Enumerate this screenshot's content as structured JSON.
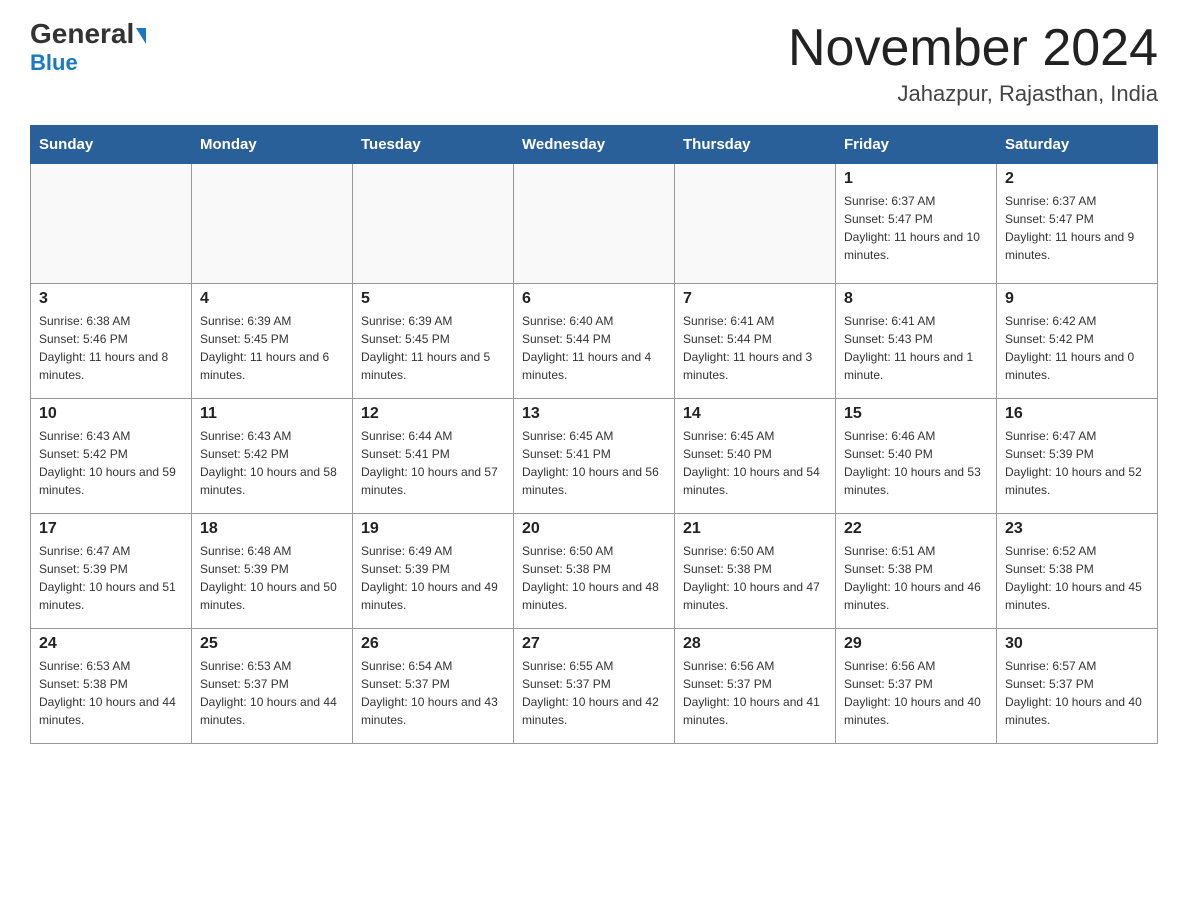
{
  "header": {
    "logo_main": "General",
    "logo_blue": "Blue",
    "month": "November 2024",
    "location": "Jahazpur, Rajasthan, India"
  },
  "days_of_week": [
    "Sunday",
    "Monday",
    "Tuesday",
    "Wednesday",
    "Thursday",
    "Friday",
    "Saturday"
  ],
  "weeks": [
    [
      {
        "day": "",
        "info": ""
      },
      {
        "day": "",
        "info": ""
      },
      {
        "day": "",
        "info": ""
      },
      {
        "day": "",
        "info": ""
      },
      {
        "day": "",
        "info": ""
      },
      {
        "day": "1",
        "info": "Sunrise: 6:37 AM\nSunset: 5:47 PM\nDaylight: 11 hours and 10 minutes."
      },
      {
        "day": "2",
        "info": "Sunrise: 6:37 AM\nSunset: 5:47 PM\nDaylight: 11 hours and 9 minutes."
      }
    ],
    [
      {
        "day": "3",
        "info": "Sunrise: 6:38 AM\nSunset: 5:46 PM\nDaylight: 11 hours and 8 minutes."
      },
      {
        "day": "4",
        "info": "Sunrise: 6:39 AM\nSunset: 5:45 PM\nDaylight: 11 hours and 6 minutes."
      },
      {
        "day": "5",
        "info": "Sunrise: 6:39 AM\nSunset: 5:45 PM\nDaylight: 11 hours and 5 minutes."
      },
      {
        "day": "6",
        "info": "Sunrise: 6:40 AM\nSunset: 5:44 PM\nDaylight: 11 hours and 4 minutes."
      },
      {
        "day": "7",
        "info": "Sunrise: 6:41 AM\nSunset: 5:44 PM\nDaylight: 11 hours and 3 minutes."
      },
      {
        "day": "8",
        "info": "Sunrise: 6:41 AM\nSunset: 5:43 PM\nDaylight: 11 hours and 1 minute."
      },
      {
        "day": "9",
        "info": "Sunrise: 6:42 AM\nSunset: 5:42 PM\nDaylight: 11 hours and 0 minutes."
      }
    ],
    [
      {
        "day": "10",
        "info": "Sunrise: 6:43 AM\nSunset: 5:42 PM\nDaylight: 10 hours and 59 minutes."
      },
      {
        "day": "11",
        "info": "Sunrise: 6:43 AM\nSunset: 5:42 PM\nDaylight: 10 hours and 58 minutes."
      },
      {
        "day": "12",
        "info": "Sunrise: 6:44 AM\nSunset: 5:41 PM\nDaylight: 10 hours and 57 minutes."
      },
      {
        "day": "13",
        "info": "Sunrise: 6:45 AM\nSunset: 5:41 PM\nDaylight: 10 hours and 56 minutes."
      },
      {
        "day": "14",
        "info": "Sunrise: 6:45 AM\nSunset: 5:40 PM\nDaylight: 10 hours and 54 minutes."
      },
      {
        "day": "15",
        "info": "Sunrise: 6:46 AM\nSunset: 5:40 PM\nDaylight: 10 hours and 53 minutes."
      },
      {
        "day": "16",
        "info": "Sunrise: 6:47 AM\nSunset: 5:39 PM\nDaylight: 10 hours and 52 minutes."
      }
    ],
    [
      {
        "day": "17",
        "info": "Sunrise: 6:47 AM\nSunset: 5:39 PM\nDaylight: 10 hours and 51 minutes."
      },
      {
        "day": "18",
        "info": "Sunrise: 6:48 AM\nSunset: 5:39 PM\nDaylight: 10 hours and 50 minutes."
      },
      {
        "day": "19",
        "info": "Sunrise: 6:49 AM\nSunset: 5:39 PM\nDaylight: 10 hours and 49 minutes."
      },
      {
        "day": "20",
        "info": "Sunrise: 6:50 AM\nSunset: 5:38 PM\nDaylight: 10 hours and 48 minutes."
      },
      {
        "day": "21",
        "info": "Sunrise: 6:50 AM\nSunset: 5:38 PM\nDaylight: 10 hours and 47 minutes."
      },
      {
        "day": "22",
        "info": "Sunrise: 6:51 AM\nSunset: 5:38 PM\nDaylight: 10 hours and 46 minutes."
      },
      {
        "day": "23",
        "info": "Sunrise: 6:52 AM\nSunset: 5:38 PM\nDaylight: 10 hours and 45 minutes."
      }
    ],
    [
      {
        "day": "24",
        "info": "Sunrise: 6:53 AM\nSunset: 5:38 PM\nDaylight: 10 hours and 44 minutes."
      },
      {
        "day": "25",
        "info": "Sunrise: 6:53 AM\nSunset: 5:37 PM\nDaylight: 10 hours and 44 minutes."
      },
      {
        "day": "26",
        "info": "Sunrise: 6:54 AM\nSunset: 5:37 PM\nDaylight: 10 hours and 43 minutes."
      },
      {
        "day": "27",
        "info": "Sunrise: 6:55 AM\nSunset: 5:37 PM\nDaylight: 10 hours and 42 minutes."
      },
      {
        "day": "28",
        "info": "Sunrise: 6:56 AM\nSunset: 5:37 PM\nDaylight: 10 hours and 41 minutes."
      },
      {
        "day": "29",
        "info": "Sunrise: 6:56 AM\nSunset: 5:37 PM\nDaylight: 10 hours and 40 minutes."
      },
      {
        "day": "30",
        "info": "Sunrise: 6:57 AM\nSunset: 5:37 PM\nDaylight: 10 hours and 40 minutes."
      }
    ]
  ]
}
